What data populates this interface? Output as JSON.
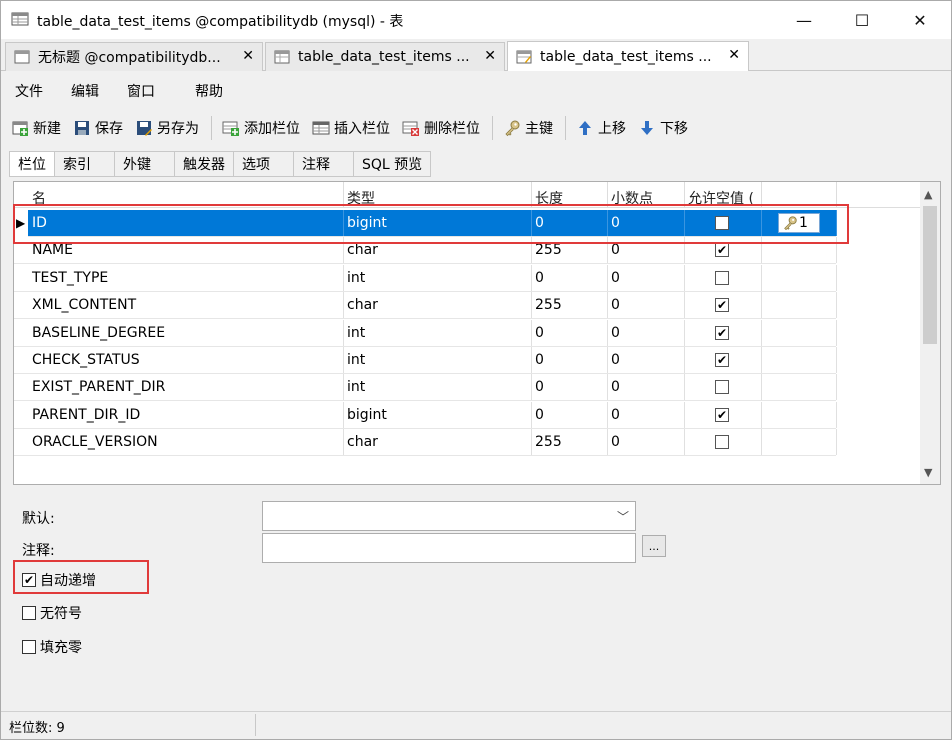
{
  "window": {
    "title": "table_data_test_items @compatibilitydb (mysql) - 表",
    "minimize": "—",
    "maximize": "☐",
    "close": "✕"
  },
  "doc_tabs": [
    {
      "label": "无标题 @compatibilitydb...",
      "close": "✕"
    },
    {
      "label": "table_data_test_items ...",
      "close": "✕"
    },
    {
      "label": "table_data_test_items ...",
      "close": "✕"
    }
  ],
  "menu": [
    "文件",
    "编辑",
    "窗口",
    "帮助"
  ],
  "toolbar": {
    "new": "新建",
    "save": "保存",
    "save_as": "另存为",
    "add_field": "添加栏位",
    "insert_field": "插入栏位",
    "delete_field": "删除栏位",
    "primary_key": "主键",
    "move_up": "上移",
    "move_down": "下移"
  },
  "sub_tabs": [
    "栏位",
    "索引",
    "外键",
    "触发器",
    "选项",
    "注释",
    "SQL 预览"
  ],
  "grid": {
    "headers": [
      "名",
      "类型",
      "长度",
      "小数点",
      "允许空值 (",
      ""
    ],
    "rows": [
      {
        "name": "ID",
        "type": "bigint",
        "length": "0",
        "decimals": "0",
        "nullable": false,
        "key": "1",
        "selected": true
      },
      {
        "name": "NAME",
        "type": "char",
        "length": "255",
        "decimals": "0",
        "nullable": true
      },
      {
        "name": "TEST_TYPE",
        "type": "int",
        "length": "0",
        "decimals": "0",
        "nullable": false
      },
      {
        "name": "XML_CONTENT",
        "type": "char",
        "length": "255",
        "decimals": "0",
        "nullable": true
      },
      {
        "name": "BASELINE_DEGREE",
        "type": "int",
        "length": "0",
        "decimals": "0",
        "nullable": true
      },
      {
        "name": "CHECK_STATUS",
        "type": "int",
        "length": "0",
        "decimals": "0",
        "nullable": true
      },
      {
        "name": "EXIST_PARENT_DIR",
        "type": "int",
        "length": "0",
        "decimals": "0",
        "nullable": false
      },
      {
        "name": "PARENT_DIR_ID",
        "type": "bigint",
        "length": "0",
        "decimals": "0",
        "nullable": true
      },
      {
        "name": "ORACLE_VERSION",
        "type": "char",
        "length": "255",
        "decimals": "0",
        "nullable": false
      }
    ]
  },
  "form": {
    "default_label": "默认:",
    "default_value": "",
    "comment_label": "注释:",
    "comment_value": "",
    "ellipsis": "...",
    "auto_increment_label": "自动递增",
    "auto_increment": true,
    "unsigned_label": "无符号",
    "unsigned": false,
    "zerofill_label": "填充零",
    "zerofill": false
  },
  "status": {
    "field_count": "栏位数: 9"
  },
  "colors": {
    "selection": "#0078d7",
    "highlight_box": "#e03a3a"
  }
}
